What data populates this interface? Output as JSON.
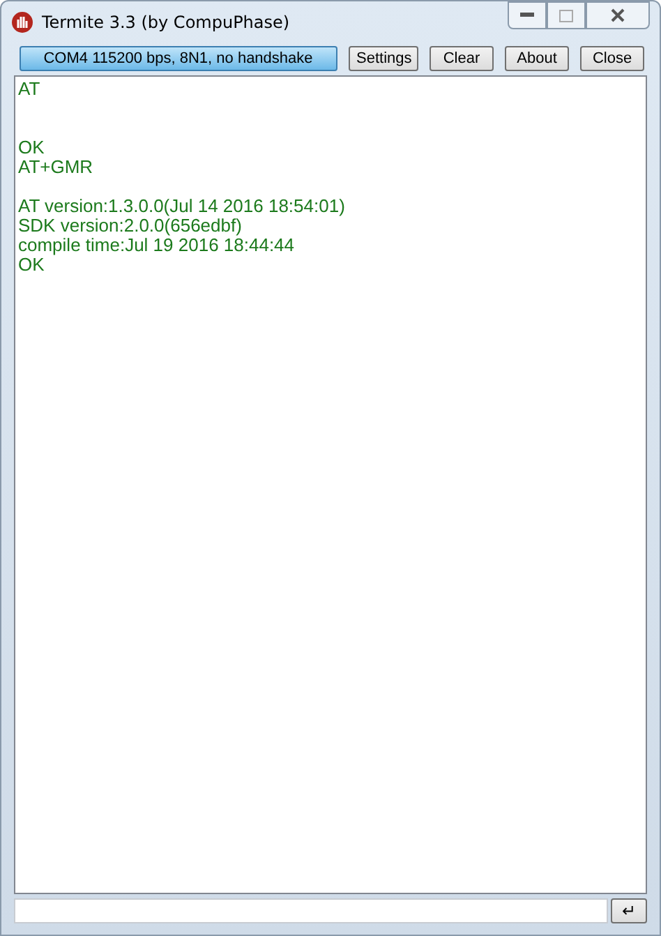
{
  "window": {
    "title": "Termite 3.3 (by CompuPhase)"
  },
  "toolbar": {
    "port_status": "COM4 115200 bps, 8N1, no handshake",
    "buttons": [
      "Settings",
      "Clear",
      "About",
      "Close"
    ]
  },
  "terminal": {
    "lines": [
      {
        "kind": "text",
        "text": "AT"
      },
      {
        "kind": "blank"
      },
      {
        "kind": "blank"
      },
      {
        "kind": "text",
        "text": "OK"
      },
      {
        "kind": "text",
        "text": "AT+GMR"
      },
      {
        "kind": "blank"
      },
      {
        "kind": "text",
        "text": "AT version:1.3.0.0(Jul 14 2016 18:54:01)"
      },
      {
        "kind": "text",
        "text": "SDK version:2.0.0(656edbf)"
      },
      {
        "kind": "text",
        "text": "compile time:Jul 19 2016 18:44:44"
      },
      {
        "kind": "text",
        "text": "OK"
      }
    ]
  },
  "input": {
    "send_key": "↵"
  }
}
